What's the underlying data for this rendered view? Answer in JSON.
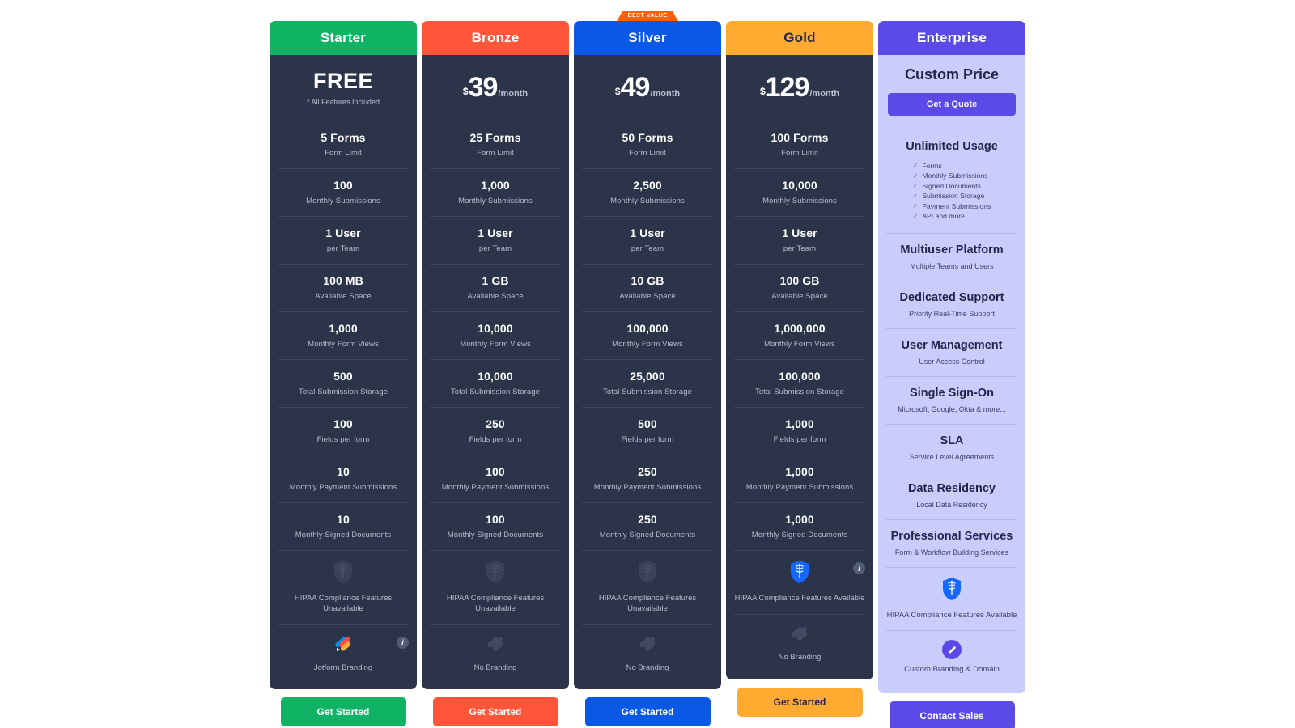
{
  "theme": {
    "page_bg": "#ffffff",
    "card_dark": "#2b3449",
    "card_light": "#c9cdfa",
    "text_light": "#ffffff",
    "text_muted": "#b4bccf",
    "text_dark": "#21264c"
  },
  "best_value_ribbon": "BEST VALUE",
  "plans": [
    {
      "name": "Starter",
      "accent": "#10b364",
      "header_text_color": "#ffffff",
      "price_type": "free",
      "price_free": "FREE",
      "price_note": "* All Features Included",
      "cta_label": "Get Started",
      "cta_text_color": "#ffffff",
      "featured": false,
      "rows": [
        {
          "value": "5 Forms",
          "label": "Form Limit"
        },
        {
          "value": "100",
          "label": "Monthly Submissions"
        },
        {
          "value": "1 User",
          "label": "per Team"
        },
        {
          "value": "100 MB",
          "label": "Available Space"
        },
        {
          "value": "1,000",
          "label": "Monthly Form Views"
        },
        {
          "value": "500",
          "label": "Total Submission Storage"
        },
        {
          "value": "100",
          "label": "Fields per form"
        },
        {
          "value": "10",
          "label": "Monthly Payment Submissions"
        },
        {
          "value": "10",
          "label": "Monthly Signed Documents"
        }
      ],
      "hipaa": {
        "icon": "shield-caduceus-icon",
        "available": false,
        "caption": "HIPAA Compliance Features Unavailable",
        "info": false
      },
      "branding": {
        "icon": "jotform-logo-icon",
        "active": true,
        "caption": "Jotform Branding",
        "info": true
      }
    },
    {
      "name": "Bronze",
      "accent": "#ff563a",
      "header_text_color": "#ffffff",
      "price_type": "paid",
      "currency": "$",
      "amount": "39",
      "period": "/month",
      "cta_label": "Get Started",
      "cta_text_color": "#ffffff",
      "featured": false,
      "rows": [
        {
          "value": "25 Forms",
          "label": "Form Limit"
        },
        {
          "value": "1,000",
          "label": "Monthly Submissions"
        },
        {
          "value": "1 User",
          "label": "per Team"
        },
        {
          "value": "1 GB",
          "label": "Available Space"
        },
        {
          "value": "10,000",
          "label": "Monthly Form Views"
        },
        {
          "value": "10,000",
          "label": "Total Submission Storage"
        },
        {
          "value": "250",
          "label": "Fields per form"
        },
        {
          "value": "100",
          "label": "Monthly Payment Submissions"
        },
        {
          "value": "100",
          "label": "Monthly Signed Documents"
        }
      ],
      "hipaa": {
        "icon": "shield-caduceus-icon",
        "available": false,
        "caption": "HIPAA Compliance Features Unavailable",
        "info": false
      },
      "branding": {
        "icon": "jotform-logo-icon",
        "active": false,
        "caption": "No Branding",
        "info": false
      }
    },
    {
      "name": "Silver",
      "accent": "#0a58e6",
      "header_text_color": "#ffffff",
      "price_type": "paid",
      "currency": "$",
      "amount": "49",
      "period": "/month",
      "cta_label": "Get Started",
      "cta_text_color": "#ffffff",
      "featured": true,
      "rows": [
        {
          "value": "50 Forms",
          "label": "Form Limit"
        },
        {
          "value": "2,500",
          "label": "Monthly Submissions"
        },
        {
          "value": "1 User",
          "label": "per Team"
        },
        {
          "value": "10 GB",
          "label": "Available Space"
        },
        {
          "value": "100,000",
          "label": "Monthly Form Views"
        },
        {
          "value": "25,000",
          "label": "Total Submission Storage"
        },
        {
          "value": "500",
          "label": "Fields per form"
        },
        {
          "value": "250",
          "label": "Monthly Payment Submissions"
        },
        {
          "value": "250",
          "label": "Monthly Signed Documents"
        }
      ],
      "hipaa": {
        "icon": "shield-caduceus-icon",
        "available": false,
        "caption": "HIPAA Compliance Features Unavailable",
        "info": false
      },
      "branding": {
        "icon": "jotform-logo-icon",
        "active": false,
        "caption": "No Branding",
        "info": false
      }
    },
    {
      "name": "Gold",
      "accent": "#ffab31",
      "header_text_color": "#21264c",
      "price_type": "paid",
      "currency": "$",
      "amount": "129",
      "period": "/month",
      "cta_label": "Get Started",
      "cta_text_color": "#21264c",
      "featured": false,
      "rows": [
        {
          "value": "100 Forms",
          "label": "Form Limit"
        },
        {
          "value": "10,000",
          "label": "Monthly Submissions"
        },
        {
          "value": "1 User",
          "label": "per Team"
        },
        {
          "value": "100 GB",
          "label": "Available Space"
        },
        {
          "value": "1,000,000",
          "label": "Monthly Form Views"
        },
        {
          "value": "100,000",
          "label": "Total Submission Storage"
        },
        {
          "value": "1,000",
          "label": "Fields per form"
        },
        {
          "value": "1,000",
          "label": "Monthly Payment Submissions"
        },
        {
          "value": "1,000",
          "label": "Monthly Signed Documents"
        }
      ],
      "hipaa": {
        "icon": "shield-caduceus-icon",
        "available": true,
        "caption": "HIPAA Compliance Features Available",
        "info": true
      },
      "branding": {
        "icon": "jotform-logo-icon",
        "active": false,
        "caption": "No Branding",
        "info": false
      }
    }
  ],
  "enterprise": {
    "name": "Enterprise",
    "accent": "#5b4ae8",
    "header_text_color": "#ffffff",
    "custom_price": "Custom Price",
    "quote_label": "Get a Quote",
    "cta_label": "Contact Sales",
    "unlimited": {
      "title": "Unlimited Usage",
      "items": [
        "Forms",
        "Monthly Submissions",
        "Signed Documents",
        "Submission Storage",
        "Payment Submissions",
        "API and more..."
      ]
    },
    "rows": [
      {
        "value": "Multiuser Platform",
        "label": "Multiple Teams and Users"
      },
      {
        "value": "Dedicated Support",
        "label": "Priority Real-Time Support"
      },
      {
        "value": "User Management",
        "label": "User Access Control"
      },
      {
        "value": "Single Sign-On",
        "label": "Microsoft, Google, Okta & more..."
      },
      {
        "value": "SLA",
        "label": "Service Level Agreements"
      },
      {
        "value": "Data Residency",
        "label": "Local Data Residency"
      },
      {
        "value": "Professional Services",
        "label": "Form & Workflow Building Services"
      }
    ],
    "hipaa": {
      "icon": "shield-caduceus-icon",
      "available": true,
      "caption": "HIPAA Compliance Features Available",
      "info": false
    },
    "branding": {
      "icon": "pen-icon",
      "caption": "Custom Branding & Domain",
      "info": false
    }
  }
}
